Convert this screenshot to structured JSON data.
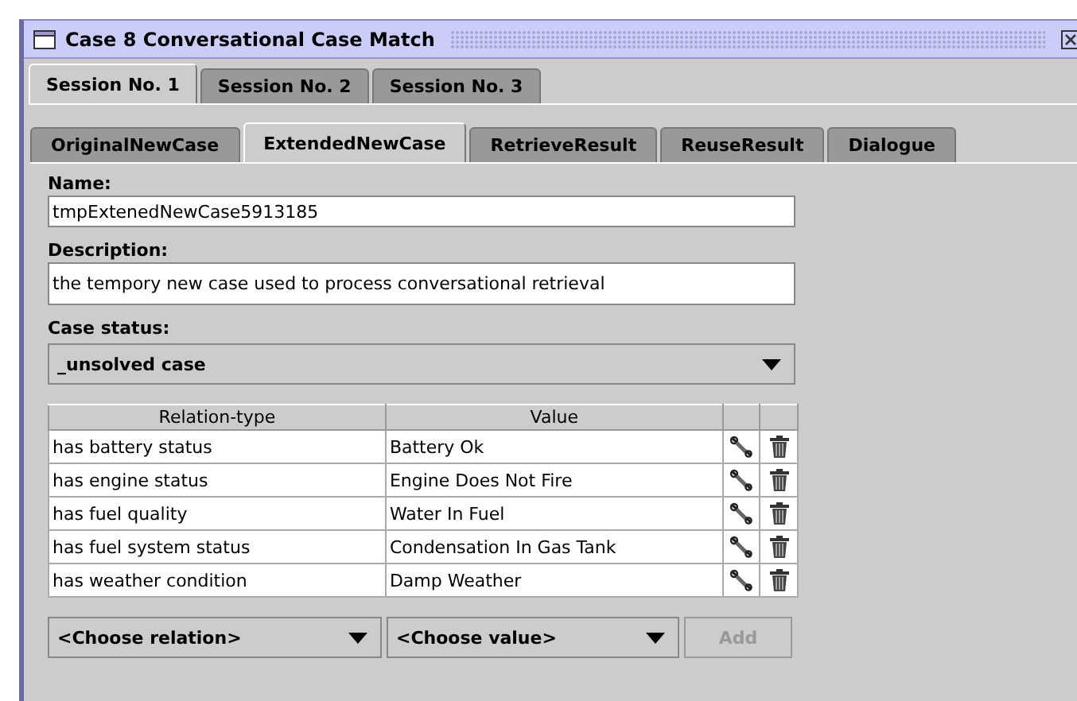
{
  "window": {
    "title": "Case 8 Conversational Case Match"
  },
  "session_tabs": [
    {
      "label": "Session No. 1",
      "selected": true
    },
    {
      "label": "Session No. 2",
      "selected": false
    },
    {
      "label": "Session No. 3",
      "selected": false
    }
  ],
  "tabs": [
    {
      "label": "OriginalNewCase",
      "selected": false
    },
    {
      "label": "ExtendedNewCase",
      "selected": true
    },
    {
      "label": "RetrieveResult",
      "selected": false
    },
    {
      "label": "ReuseResult",
      "selected": false
    },
    {
      "label": "Dialogue",
      "selected": false
    }
  ],
  "name": {
    "label": "Name:",
    "value": "tmpExtenedNewCase5913185"
  },
  "description": {
    "label": "Description:",
    "value": "the tempory new case used to process conversational retrieval"
  },
  "case_status": {
    "label": "Case status:",
    "value": "_unsolved case"
  },
  "table": {
    "columns": [
      "Relation-type",
      "Value"
    ],
    "rows": [
      {
        "relation": "has battery status",
        "value": "Battery Ok"
      },
      {
        "relation": "has engine status",
        "value": "Engine Does Not Fire"
      },
      {
        "relation": "has fuel quality",
        "value": "Water In Fuel"
      },
      {
        "relation": "has fuel system status",
        "value": "Condensation In Gas Tank"
      },
      {
        "relation": "has weather condition",
        "value": "Damp Weather"
      }
    ]
  },
  "relation_select": {
    "value": "<Choose relation>"
  },
  "value_select": {
    "value": "<Choose value>"
  },
  "add_button": {
    "label": "Add",
    "disabled": true
  }
}
